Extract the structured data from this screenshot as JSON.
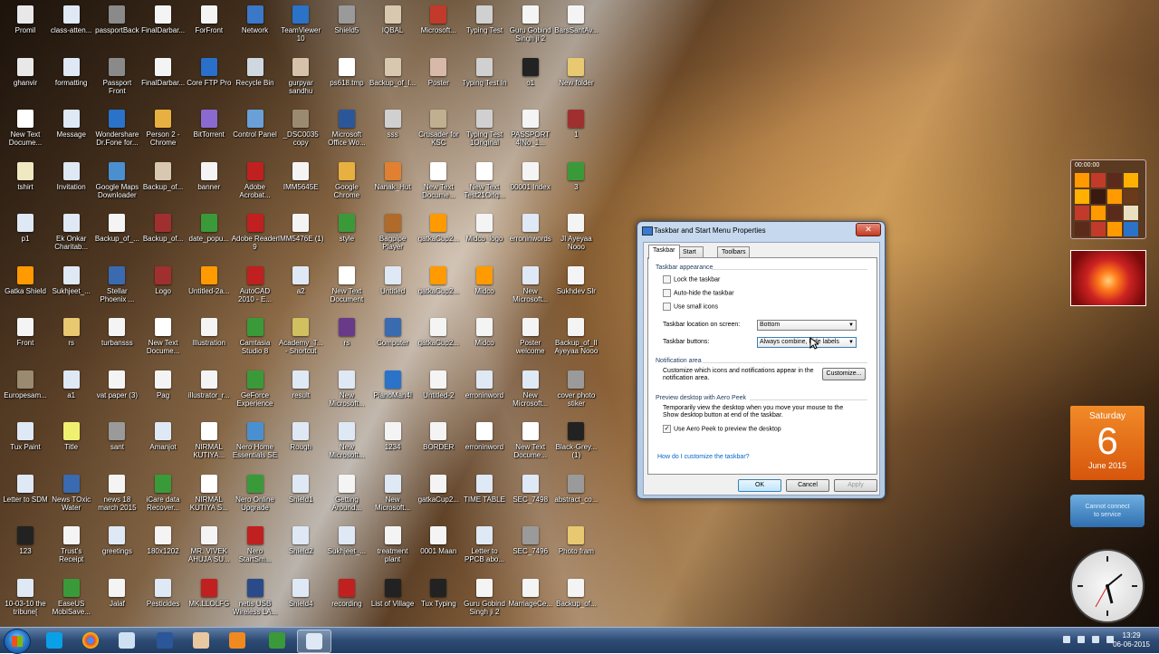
{
  "desktop": {
    "icons": [
      {
        "label": "Promil",
        "color": "#e8e8e8"
      },
      {
        "label": "class-atten...",
        "color": "#dfe8f5"
      },
      {
        "label": "passportBack",
        "color": "#8a8a8a"
      },
      {
        "label": "FinalDarbar...",
        "color": "#f4f4f4"
      },
      {
        "label": "ForFront",
        "color": "#f4f4f4"
      },
      {
        "label": "Network",
        "color": "#3b78c8"
      },
      {
        "label": "TeamViewer 10",
        "color": "#2a73c9"
      },
      {
        "label": "Shield5",
        "color": "#9a9a9a"
      },
      {
        "label": "IQBAL",
        "color": "#d8c8b0"
      },
      {
        "label": "Microsoft...",
        "color": "#c23a2a"
      },
      {
        "label": "Typing Test",
        "color": "#d0d0d0"
      },
      {
        "label": "Guru Gobind Singh ji 2",
        "color": "#f4f4f4"
      },
      {
        "label": "BarsSantAv...",
        "color": "#f4f4f4"
      },
      {
        "label": "ghanvir",
        "color": "#e8e8e8"
      },
      {
        "label": "formatting",
        "color": "#dfe8f5"
      },
      {
        "label": "Passport Front",
        "color": "#8a8a8a"
      },
      {
        "label": "FinalDarbar...",
        "color": "#f4f4f4"
      },
      {
        "label": "Core FTP Pro",
        "color": "#2a6fc9"
      },
      {
        "label": "Recycle Bin",
        "color": "#cfd8e0"
      },
      {
        "label": "gurpyar sandhu",
        "color": "#d6c2a8"
      },
      {
        "label": "ps618.tmp",
        "color": "#ffffff"
      },
      {
        "label": "Backup_of_I...",
        "color": "#d8c8b0"
      },
      {
        "label": "Poster",
        "color": "#d8b8a8"
      },
      {
        "label": "Typing Test In",
        "color": "#d0d0d0"
      },
      {
        "label": "o1",
        "color": "#222222"
      },
      {
        "label": "New folder",
        "color": "#e8c870"
      },
      {
        "label": "New Text Docume...",
        "color": "#ffffff"
      },
      {
        "label": "Message",
        "color": "#dfe8f5"
      },
      {
        "label": "Wondershare Dr.Fone for...",
        "color": "#2a73c9"
      },
      {
        "label": "Person 2 - Chrome",
        "color": "#e8b040"
      },
      {
        "label": "BitTorrent",
        "color": "#8a6ad0"
      },
      {
        "label": "Control Panel",
        "color": "#6aa0d8"
      },
      {
        "label": "_DSC0035 copy",
        "color": "#9a8a70"
      },
      {
        "label": "Microsoft Office Wo...",
        "color": "#2b579a"
      },
      {
        "label": "sss",
        "color": "#d0d0d0"
      },
      {
        "label": "Crusader for KSC",
        "color": "#c0b090"
      },
      {
        "label": "Typing Test 1Original",
        "color": "#d0d0d0"
      },
      {
        "label": "PASSPORT 4[No_1...",
        "color": "#f4f4f4"
      },
      {
        "label": "1",
        "color": "#a03030"
      },
      {
        "label": "tshirt",
        "color": "#f0e8c0"
      },
      {
        "label": "Invitation",
        "color": "#dfe8f5"
      },
      {
        "label": "Google Maps Downloader",
        "color": "#4a90d0"
      },
      {
        "label": "Backup_of...",
        "color": "#d8c8b0"
      },
      {
        "label": "banner",
        "color": "#f4f4f4"
      },
      {
        "label": "Adobe Acrobat...",
        "color": "#c02020"
      },
      {
        "label": "IMM5645E",
        "color": "#f4f4f4"
      },
      {
        "label": "Google Chrome",
        "color": "#e8b040"
      },
      {
        "label": "Nanak_Hut",
        "color": "#e08030"
      },
      {
        "label": "New Text Docume...",
        "color": "#ffffff"
      },
      {
        "label": "New Text Test21Orig...",
        "color": "#ffffff"
      },
      {
        "label": "00001 Index",
        "color": "#f4f4f4"
      },
      {
        "label": "3",
        "color": "#3a9a3a"
      },
      {
        "label": "p1",
        "color": "#dfe8f5"
      },
      {
        "label": "Ek Onkar Charitab...",
        "color": "#dfe8f5"
      },
      {
        "label": "Backup_of_...",
        "color": "#f4f4f4"
      },
      {
        "label": "Backup_of...",
        "color": "#a03030"
      },
      {
        "label": "date_popu...",
        "color": "#3a9a3a"
      },
      {
        "label": "Adobe Reader 9",
        "color": "#c02020"
      },
      {
        "label": "IMM5476E (1)",
        "color": "#f4f4f4"
      },
      {
        "label": "style",
        "color": "#3a9a3a"
      },
      {
        "label": "Bagpipe Player",
        "color": "#b06a2a"
      },
      {
        "label": "gatkaCup2...",
        "color": "#ff9a00"
      },
      {
        "label": "Midco_logo",
        "color": "#f4f4f4"
      },
      {
        "label": "erroninwords",
        "color": "#dfe8f5"
      },
      {
        "label": "JI Ayeyaa Nooo",
        "color": "#f4f4f4"
      },
      {
        "label": "Gatka Shield",
        "color": "#ff9a00"
      },
      {
        "label": "Sukhjeet_...",
        "color": "#dfe8f5"
      },
      {
        "label": "Stellar Phoenix ...",
        "color": "#3a6ab0"
      },
      {
        "label": "Logo",
        "color": "#a03030"
      },
      {
        "label": "Untitled-2a...",
        "color": "#ff9a00"
      },
      {
        "label": "AutoCAD 2010 - E...",
        "color": "#c02020"
      },
      {
        "label": "a2",
        "color": "#dfe8f5"
      },
      {
        "label": "New Text Document",
        "color": "#ffffff"
      },
      {
        "label": "Untitled",
        "color": "#dfe8f5"
      },
      {
        "label": "gatkaCup2...",
        "color": "#ff9a00"
      },
      {
        "label": "Midco",
        "color": "#ff9a00"
      },
      {
        "label": "New Microsoft...",
        "color": "#dfe8f5"
      },
      {
        "label": "Sukhdev Slr",
        "color": "#f4f4f4"
      },
      {
        "label": "Front",
        "color": "#f4f4f4"
      },
      {
        "label": "rs",
        "color": "#e8c870"
      },
      {
        "label": "turbansss",
        "color": "#f4f4f4"
      },
      {
        "label": "New Text Docume...",
        "color": "#ffffff"
      },
      {
        "label": "Illustration",
        "color": "#f4f4f4"
      },
      {
        "label": "Camtasia Studio 8",
        "color": "#3a9a3a"
      },
      {
        "label": "Academy_T... - Shortcut",
        "color": "#d0c060"
      },
      {
        "label": "rs",
        "color": "#6a3a8a"
      },
      {
        "label": "Computer",
        "color": "#3a6ab0"
      },
      {
        "label": "gatkaCup2...",
        "color": "#f4f4f4"
      },
      {
        "label": "Midco",
        "color": "#f4f4f4"
      },
      {
        "label": "Poster welcome",
        "color": "#f4f4f4"
      },
      {
        "label": "Backup_of_II Ayeyaa Nooo",
        "color": "#f4f4f4"
      },
      {
        "label": "Europesam...",
        "color": "#9a8a70"
      },
      {
        "label": "a1",
        "color": "#dfe8f5"
      },
      {
        "label": "vat paper (3)",
        "color": "#f4f4f4"
      },
      {
        "label": "Pag",
        "color": "#f4f4f4"
      },
      {
        "label": "illustrator_r...",
        "color": "#f4f4f4"
      },
      {
        "label": "GeForce Experience",
        "color": "#3a9a3a"
      },
      {
        "label": "result",
        "color": "#dfe8f5"
      },
      {
        "label": "New Microsoft...",
        "color": "#dfe8f5"
      },
      {
        "label": "PianoMan4l",
        "color": "#2a73c9"
      },
      {
        "label": "Untitled-2",
        "color": "#f4f4f4"
      },
      {
        "label": "erroninword",
        "color": "#dfe8f5"
      },
      {
        "label": "New Microsoft...",
        "color": "#dfe8f5"
      },
      {
        "label": "cover photo stiker",
        "color": "#9a9a9a"
      },
      {
        "label": "Tux Paint",
        "color": "#dfe8f5"
      },
      {
        "label": "Title",
        "color": "#f0f070"
      },
      {
        "label": "sant",
        "color": "#9a9a9a"
      },
      {
        "label": "Amanjot",
        "color": "#dfe8f5"
      },
      {
        "label": "NIRMAL KUTIYA...",
        "color": "#ffffff"
      },
      {
        "label": "Nero Home Essentials SE",
        "color": "#4a90d0"
      },
      {
        "label": "Rough",
        "color": "#dfe8f5"
      },
      {
        "label": "New Microsoft...",
        "color": "#dfe8f5"
      },
      {
        "label": "1234",
        "color": "#f4f4f4"
      },
      {
        "label": "BORDER",
        "color": "#f4f4f4"
      },
      {
        "label": "erroninword",
        "color": "#ffffff"
      },
      {
        "label": "New Text Docume...",
        "color": "#ffffff"
      },
      {
        "label": "Black-Grey... (1)",
        "color": "#222222"
      },
      {
        "label": "Letter to SDM",
        "color": "#dfe8f5"
      },
      {
        "label": "News TOxic Water",
        "color": "#3a6ab0"
      },
      {
        "label": "news 18 march 2015",
        "color": "#f4f4f4"
      },
      {
        "label": "iCare data Recover...",
        "color": "#3a9a3a"
      },
      {
        "label": "NIRMAL KUTIYA S...",
        "color": "#ffffff"
      },
      {
        "label": "Nero Online Upgrade",
        "color": "#3a9a3a"
      },
      {
        "label": "Shield1",
        "color": "#dfe8f5"
      },
      {
        "label": "Getting Around...",
        "color": "#f4f4f4"
      },
      {
        "label": "New Microsoft...",
        "color": "#dfe8f5"
      },
      {
        "label": "gatkaCup2...",
        "color": "#f4f4f4"
      },
      {
        "label": "TIME TABLE",
        "color": "#dfe8f5"
      },
      {
        "label": "SEC_7498",
        "color": "#dfe8f5"
      },
      {
        "label": "abstract_co...",
        "color": "#9a9a9a"
      },
      {
        "label": "123",
        "color": "#222222"
      },
      {
        "label": "Trust's Receipt",
        "color": "#f4f4f4"
      },
      {
        "label": "greetings",
        "color": "#dfe8f5"
      },
      {
        "label": "180x1202",
        "color": "#f4f4f4"
      },
      {
        "label": "MR. VIVEK AHUJA SU...",
        "color": "#f4f4f4"
      },
      {
        "label": "Nero StartSm...",
        "color": "#c02020"
      },
      {
        "label": "Shield2",
        "color": "#dfe8f5"
      },
      {
        "label": "Sukhjeet_...",
        "color": "#dfe8f5"
      },
      {
        "label": "treatment plant",
        "color": "#f4f4f4"
      },
      {
        "label": "0001 Maan",
        "color": "#f4f4f4"
      },
      {
        "label": "Letter to PPCB abo...",
        "color": "#dfe8f5"
      },
      {
        "label": "SEC_7496",
        "color": "#9a9a9a"
      },
      {
        "label": "Photo fram",
        "color": "#e8c870"
      },
      {
        "label": "10-03-10 the tribune[",
        "color": "#dfe8f5"
      },
      {
        "label": "EaseUS MobiSave...",
        "color": "#3a9a3a"
      },
      {
        "label": "Jalaf",
        "color": "#f4f4f4"
      },
      {
        "label": "Pesticides",
        "color": "#dfe8f5"
      },
      {
        "label": "MK.LLOLFG",
        "color": "#c02020"
      },
      {
        "label": "netis USB Wireless LA...",
        "color": "#2a4a8a"
      },
      {
        "label": "Shield4",
        "color": "#dfe8f5"
      },
      {
        "label": "recording",
        "color": "#c02020"
      },
      {
        "label": "List of Village",
        "color": "#222222"
      },
      {
        "label": "Tux Typing",
        "color": "#222222"
      },
      {
        "label": "Guru Gobind Singh ji 2",
        "color": "#f4f4f4"
      },
      {
        "label": "MarriageCe...",
        "color": "#f4f4f4"
      },
      {
        "label": "Backup_of...",
        "color": "#f4f4f4"
      }
    ]
  },
  "gadgets": {
    "tiles_timer": "00:00:00",
    "calendar": {
      "weekday": "Saturday",
      "day": "6",
      "month_year": "June 2015"
    },
    "news": {
      "line1": "Cannot connect",
      "line2": "to service"
    }
  },
  "dialog": {
    "title": "Taskbar and Start Menu Properties",
    "close_glyph": "✕",
    "tabs": [
      "Taskbar",
      "Start Menu",
      "Toolbars"
    ],
    "appearance_heading": "Taskbar appearance",
    "lock_label": "Lock the taskbar",
    "autohide_label": "Auto-hide the taskbar",
    "smallicons_label": "Use small icons",
    "location_label": "Taskbar location on screen:",
    "location_value": "Bottom",
    "buttons_label": "Taskbar buttons:",
    "buttons_value": "Always combine, hide labels",
    "notif_heading": "Notification area",
    "notif_text": "Customize which icons and notifications appear in the notification area.",
    "customize_label": "Customize...",
    "peek_heading": "Preview desktop with Aero Peek",
    "peek_text": "Temporarily view the desktop when you move your mouse to the Show desktop button at end of the taskbar.",
    "peek_checkbox": "Use Aero Peek to preview the desktop",
    "help_link": "How do I customize the taskbar?",
    "ok_label": "OK",
    "cancel_label": "Cancel",
    "apply_label": "Apply",
    "check_glyph": "✓"
  },
  "taskbar": {
    "time": "13:29",
    "date": "06-06-2015"
  }
}
